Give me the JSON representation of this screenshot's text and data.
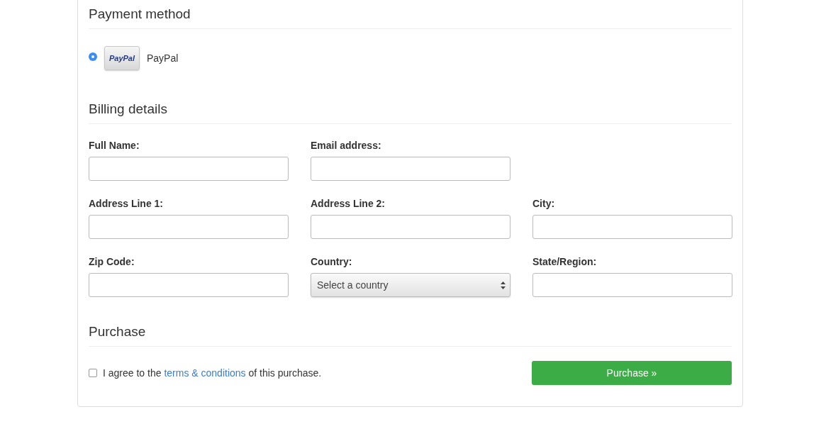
{
  "payment_method": {
    "title": "Payment method",
    "options": [
      {
        "logo_text": "PayPal",
        "label": "PayPal",
        "selected": true
      }
    ]
  },
  "billing_details": {
    "title": "Billing details",
    "rows": [
      [
        {
          "label": "Full Name:",
          "kind": "text"
        },
        {
          "label": "Email address:",
          "kind": "text"
        }
      ],
      [
        {
          "label": "Address Line 1:",
          "kind": "text"
        },
        {
          "label": "Address Line 2:",
          "kind": "text"
        },
        {
          "label": "City:",
          "kind": "text"
        }
      ],
      [
        {
          "label": "Zip Code:",
          "kind": "text"
        },
        {
          "label": "Country:",
          "kind": "select",
          "value": "Select a country"
        },
        {
          "label": "State/Region:",
          "kind": "text"
        }
      ]
    ]
  },
  "purchase": {
    "title": "Purchase",
    "agree": {
      "checked": false,
      "before": "I agree to the",
      "link": "terms & conditions",
      "after": "of this purchase."
    },
    "button": "Purchase »"
  }
}
